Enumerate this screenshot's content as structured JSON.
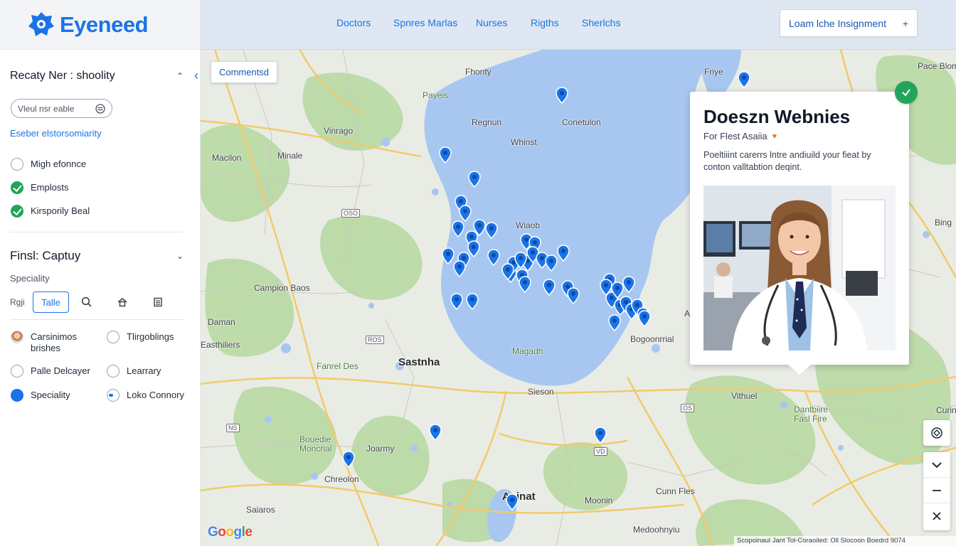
{
  "brand": {
    "name": "Eyeneed"
  },
  "sidebar": {
    "section1": {
      "title": "Recaty Ner : shoolity",
      "input_placeholder": "Vleul nsr eable",
      "link": "Eseber elstorsomiarity",
      "options": [
        {
          "label": "Migh efonnce",
          "state": "unchecked"
        },
        {
          "label": "Emplosts",
          "state": "checked"
        },
        {
          "label": "Kirsporily Beal",
          "state": "checked"
        }
      ]
    },
    "section2": {
      "title": "Finsl: Captuy",
      "specialty_label": "Speciality",
      "chip_text": "Rgji",
      "chip_button": "Talle",
      "options_left": [
        {
          "label": "Carsinimos brishes",
          "state": "avatar"
        },
        {
          "label": "Palle Delcayer",
          "state": "unchecked"
        },
        {
          "label": "Speciality",
          "state": "filled"
        }
      ],
      "options_right": [
        {
          "label": "Tlirgoblings",
          "state": "unchecked"
        },
        {
          "label": "Learrary",
          "state": "unchecked"
        },
        {
          "label": "Loko Connory",
          "state": "partial"
        }
      ]
    }
  },
  "topbar": {
    "nav": [
      "Doctors",
      "Spnres Marlas",
      "Nurses",
      "Rigths",
      "Sherlchs"
    ],
    "button_label": "Loam lche Insignment",
    "button_plus": "+"
  },
  "map": {
    "comment_button": "Commentsd",
    "labels": [
      "Fhonty",
      "Payeis",
      "Regnun",
      "Conetulon",
      "Whinst",
      "Vinrago",
      "Macilon",
      "Minale",
      "Fnye",
      "Pace Blom",
      "Wiaob",
      "Bing",
      "Campion Baos",
      "Daman",
      "Easthiliers",
      "Fanrel Des",
      "Sastnha",
      "Magadh",
      "Sieson",
      "Bogoonrrial",
      "Vithuel",
      "Dantbiire Fasl Fire",
      "Curinte",
      "Bouedie Moncrial",
      "Joarmy",
      "Chreolon",
      "Aninat",
      "Moonin",
      "Cunn Fles",
      "Saiaros",
      "Medoohnyiu",
      "Ashon"
    ],
    "shields": [
      "OSO",
      "ROS",
      "NS",
      "OS",
      "VD"
    ],
    "attribution": "Scopoinaul Jant Tol-Coraoiled: Oll Slocoon Boedrd 9074"
  },
  "card": {
    "title": "Doeszn Webnies",
    "subtitle": "For Flest Asaiia",
    "description": "Poeltiiint carerrs lntre andiuild your fieat by conton valltabtion deqint."
  },
  "colors": {
    "accent": "#1a73e8",
    "success": "#22a55b",
    "water": "#a8c7f0",
    "park": "#b9d9a3",
    "road": "#f3c969"
  },
  "icons": {
    "collapse": "chevron-left-icon",
    "search": "search-icon",
    "home": "home-icon",
    "list": "list-icon",
    "expand": "chevron-up-icon",
    "check": "check-icon",
    "zoom_in": "plus-icon",
    "zoom_out": "minus-icon"
  }
}
